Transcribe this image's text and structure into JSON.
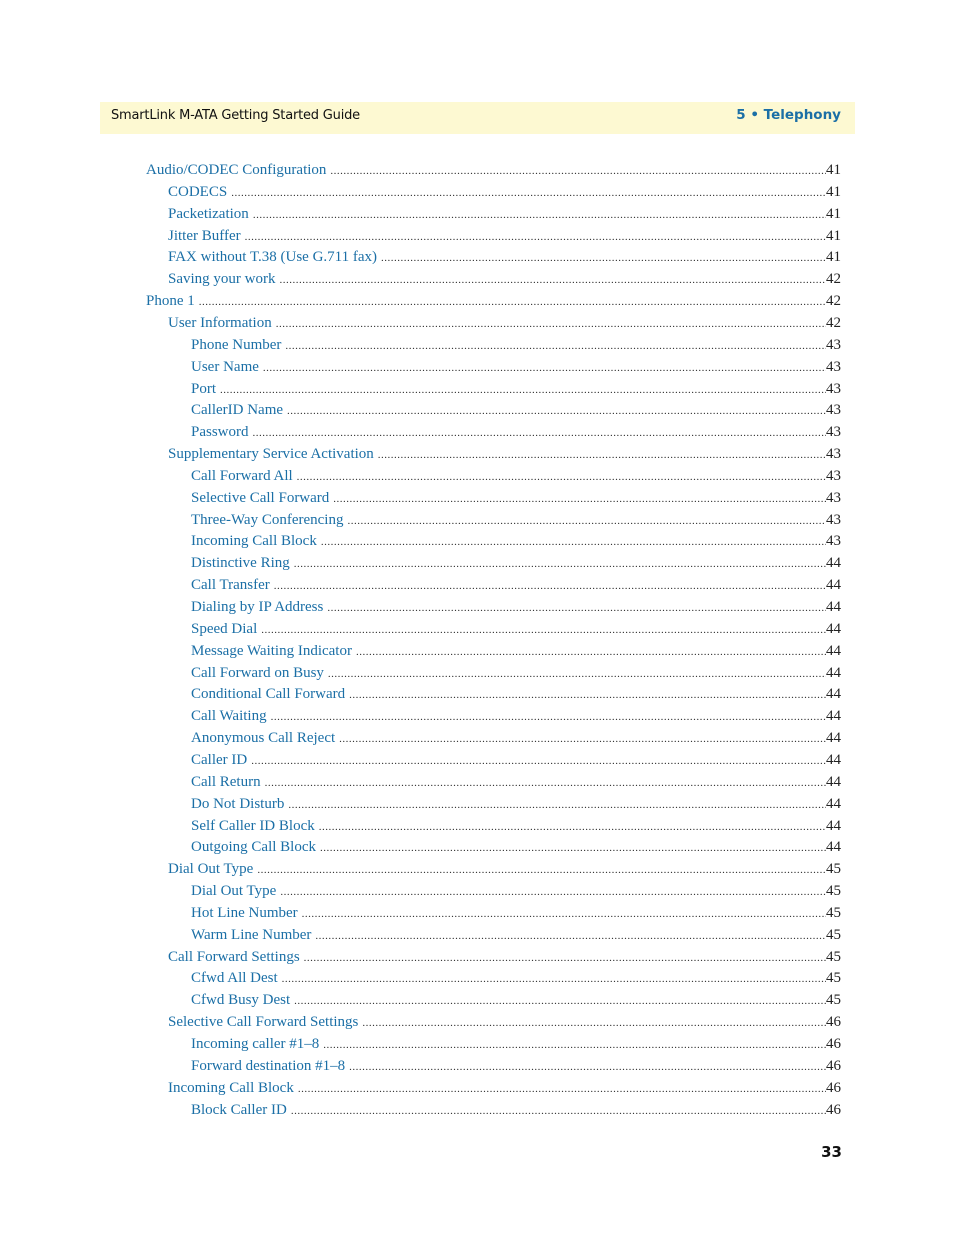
{
  "header": {
    "doc_title": "SmartLink M-ATA Getting Started Guide",
    "chapter": "5 • Telephony"
  },
  "toc": [
    {
      "label": "Audio/CODEC Configuration",
      "page": "41",
      "level": 1
    },
    {
      "label": "CODECS",
      "page": "41",
      "level": 2
    },
    {
      "label": "Packetization",
      "page": "41",
      "level": 2
    },
    {
      "label": "Jitter Buffer",
      "page": "41",
      "level": 2
    },
    {
      "label": "FAX without T.38 (Use G.711 fax)",
      "page": "41",
      "level": 2
    },
    {
      "label": "Saving your work",
      "page": "42",
      "level": 2
    },
    {
      "label": "Phone 1",
      "page": "42",
      "level": 1
    },
    {
      "label": "User Information",
      "page": "42",
      "level": 2
    },
    {
      "label": "Phone Number",
      "page": "43",
      "level": 3
    },
    {
      "label": "User Name",
      "page": "43",
      "level": 3
    },
    {
      "label": "Port",
      "page": "43",
      "level": 3
    },
    {
      "label": "CallerID Name",
      "page": "43",
      "level": 3
    },
    {
      "label": "Password",
      "page": "43",
      "level": 3
    },
    {
      "label": "Supplementary Service Activation",
      "page": "43",
      "level": 2
    },
    {
      "label": "Call Forward All",
      "page": "43",
      "level": 3
    },
    {
      "label": "Selective Call Forward",
      "page": "43",
      "level": 3
    },
    {
      "label": "Three-Way Conferencing",
      "page": "43",
      "level": 3
    },
    {
      "label": "Incoming Call Block",
      "page": "43",
      "level": 3
    },
    {
      "label": "Distinctive Ring",
      "page": "44",
      "level": 3
    },
    {
      "label": "Call Transfer",
      "page": "44",
      "level": 3
    },
    {
      "label": "Dialing by IP Address",
      "page": "44",
      "level": 3
    },
    {
      "label": "Speed Dial",
      "page": "44",
      "level": 3
    },
    {
      "label": "Message Waiting Indicator",
      "page": "44",
      "level": 3
    },
    {
      "label": "Call Forward on Busy",
      "page": "44",
      "level": 3
    },
    {
      "label": "Conditional Call Forward",
      "page": "44",
      "level": 3
    },
    {
      "label": "Call Waiting",
      "page": "44",
      "level": 3
    },
    {
      "label": "Anonymous Call Reject",
      "page": "44",
      "level": 3
    },
    {
      "label": "Caller ID",
      "page": "44",
      "level": 3
    },
    {
      "label": "Call Return",
      "page": "44",
      "level": 3
    },
    {
      "label": "Do Not Disturb",
      "page": "44",
      "level": 3
    },
    {
      "label": "Self Caller ID Block",
      "page": "44",
      "level": 3
    },
    {
      "label": "Outgoing Call Block",
      "page": "44",
      "level": 3
    },
    {
      "label": "Dial Out Type",
      "page": "45",
      "level": 2
    },
    {
      "label": "Dial Out Type",
      "page": "45",
      "level": 3
    },
    {
      "label": "Hot Line Number",
      "page": "45",
      "level": 3
    },
    {
      "label": "Warm Line Number",
      "page": "45",
      "level": 3
    },
    {
      "label": "Call Forward Settings",
      "page": "45",
      "level": 2
    },
    {
      "label": "Cfwd All Dest",
      "page": "45",
      "level": 3
    },
    {
      "label": "Cfwd Busy Dest",
      "page": "45",
      "level": 3
    },
    {
      "label": "Selective Call Forward Settings",
      "page": "46",
      "level": 2
    },
    {
      "label": "Incoming caller #1–8",
      "page": "46",
      "level": 3
    },
    {
      "label": "Forward destination #1–8",
      "page": "46",
      "level": 3
    },
    {
      "label": "Incoming Call Block",
      "page": "46",
      "level": 2
    },
    {
      "label": "Block Caller ID",
      "page": "46",
      "level": 3
    }
  ],
  "footer": {
    "page_number": "33"
  }
}
